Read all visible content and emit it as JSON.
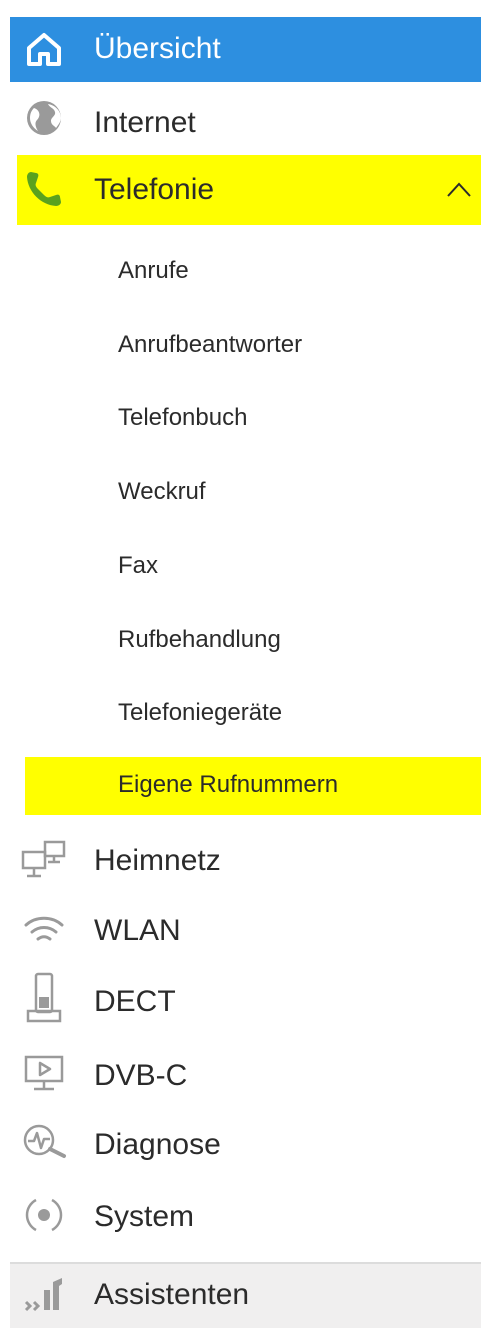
{
  "nav": {
    "overview": {
      "label": "Übersicht",
      "icon": "home-icon"
    },
    "internet": {
      "label": "Internet",
      "icon": "globe-icon"
    },
    "telefonie": {
      "label": "Telefonie",
      "icon": "phone-icon",
      "expand_icon": "chevron-up-icon",
      "items": [
        {
          "label": "Anrufe"
        },
        {
          "label": "Anrufbeantworter"
        },
        {
          "label": "Telefonbuch"
        },
        {
          "label": "Weckruf"
        },
        {
          "label": "Fax"
        },
        {
          "label": "Rufbehandlung"
        },
        {
          "label": "Telefoniegeräte"
        },
        {
          "label": "Eigene Rufnummern"
        }
      ]
    },
    "heimnetz": {
      "label": "Heimnetz",
      "icon": "network-icon"
    },
    "wlan": {
      "label": "WLAN",
      "icon": "wifi-icon"
    },
    "dect": {
      "label": "DECT",
      "icon": "dect-phone-icon"
    },
    "dvbc": {
      "label": "DVB-C",
      "icon": "tv-icon"
    },
    "diagnose": {
      "label": "Diagnose",
      "icon": "diagnose-icon"
    },
    "system": {
      "label": "System",
      "icon": "system-icon"
    },
    "assistenten": {
      "label": "Assistenten",
      "icon": "assistant-icon"
    }
  },
  "colors": {
    "active_bg": "#2d8fe0",
    "highlight": "#ffff00",
    "phone_green": "#5aa21e",
    "icon_gray": "#9a9a9a"
  }
}
